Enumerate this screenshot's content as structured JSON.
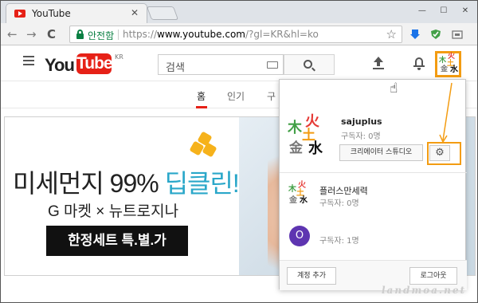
{
  "browser": {
    "tab_title": "YouTube",
    "close_glyph": "✕",
    "secure_label": "안전함",
    "url_scheme": "https://",
    "url_host": "www.youtube.com",
    "url_path": "/?gl=KR&hl=ko",
    "star_glyph": "☆",
    "back_glyph": "←",
    "forward_glyph": "→",
    "reload_glyph": "C",
    "win_minimize": "—",
    "win_maximize": "☐",
    "win_close": "✕"
  },
  "header": {
    "logo_you": "You",
    "logo_tube": "Tube",
    "logo_region": "KR",
    "search_placeholder": "검색"
  },
  "subnav": {
    "tabs": [
      {
        "label": "홈",
        "active": true
      },
      {
        "label": "인기",
        "active": false
      },
      {
        "label": "구",
        "active": false
      }
    ]
  },
  "ad": {
    "headline_prefix": "미세먼지 99% ",
    "headline_highlight": "딥클린!",
    "subline": "G 마켓 × 뉴트로지나",
    "cta": "한정세트 특.별.가"
  },
  "account_menu": {
    "channel_name": "sajuplus",
    "channel_subs": "구독자: 0명",
    "studio_button": "크리에이터 스튜디오",
    "gear_glyph": "⚙",
    "other_accounts": [
      {
        "name": "플러스만세력",
        "subs": "구독자: 0명",
        "avatar": "hanja"
      },
      {
        "name": "",
        "subs": "구독자: 1명",
        "avatar": "O"
      }
    ],
    "add_account_button": "계정 추가",
    "logout_button": "로그아웃"
  },
  "avatar_hanja": {
    "top": "火",
    "left": "木",
    "mid": "土",
    "bottom_left": "金",
    "bottom_right": "水"
  },
  "colors": {
    "brand_red": "#e62117",
    "highlight": "#f39c12",
    "ad_accent": "#2aa7c9",
    "avatar_purple": "#5e35b1"
  },
  "watermark": "landmoa.net"
}
